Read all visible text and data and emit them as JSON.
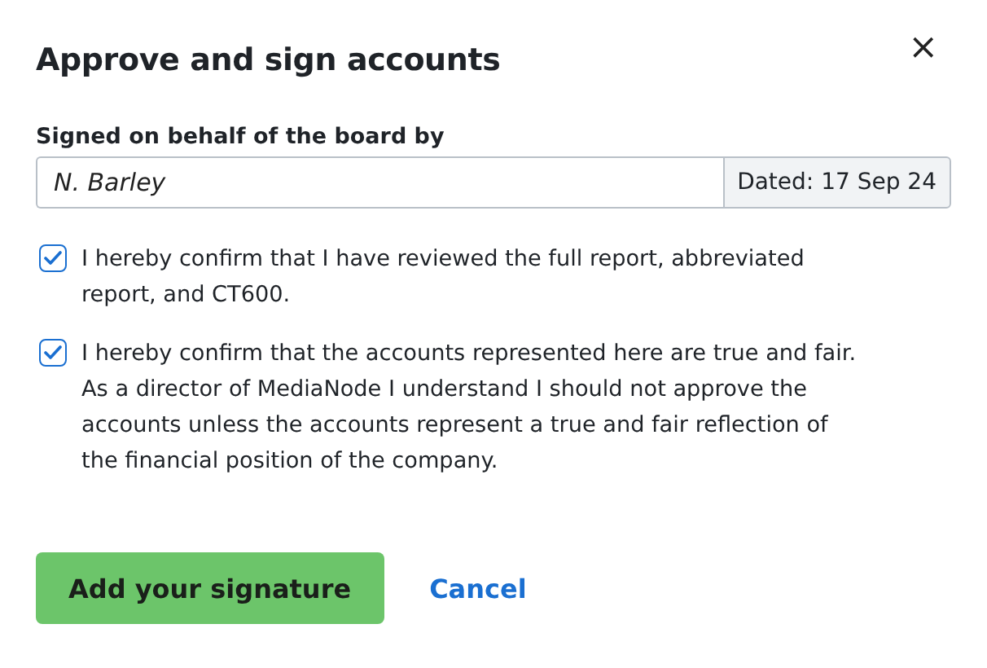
{
  "dialog": {
    "title": "Approve and sign accounts",
    "close": "×"
  },
  "signature": {
    "label": "Signed on behalf of the board by",
    "value": "N. Barley",
    "dated": "Dated: 17 Sep 24"
  },
  "confirmations": [
    {
      "text": "I hereby confirm that I have reviewed the full report, abbreviated report, and CT600.",
      "checked": true
    },
    {
      "text": "I hereby confirm that the accounts represented here are true and fair. As a director of MediaNode I understand I should not approve the accounts unless the accounts represent a true and fair reflection of the financial position of the company.",
      "checked": true
    }
  ],
  "buttons": {
    "primary": "Add your signature",
    "secondary": "Cancel"
  }
}
